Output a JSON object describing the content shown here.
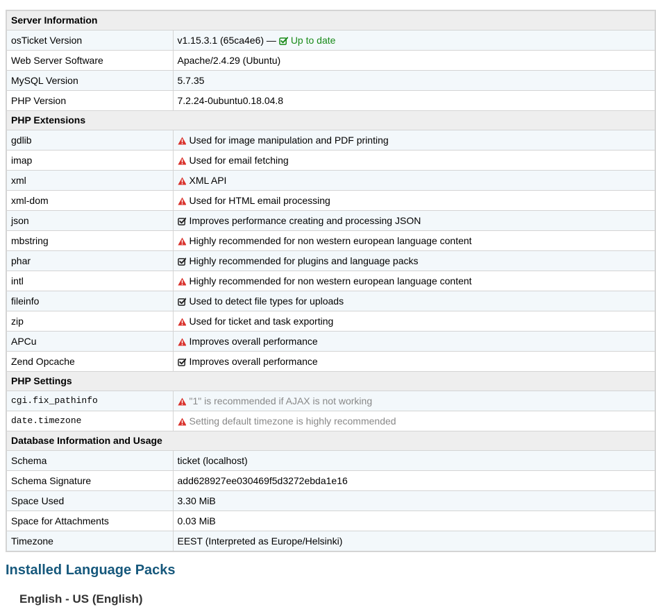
{
  "sections": [
    {
      "title": "Server Information",
      "rows": [
        {
          "key": "osTicket Version",
          "value": "v1.15.3.1 (65ca4e6) —",
          "status": "check-green",
          "extra": "Up to date"
        },
        {
          "key": "Web Server Software",
          "value": "Apache/2.4.29 (Ubuntu)"
        },
        {
          "key": "MySQL Version",
          "value": "5.7.35"
        },
        {
          "key": "PHP Version",
          "value": "7.2.24-0ubuntu0.18.04.8"
        }
      ]
    },
    {
      "title": "PHP Extensions",
      "rows": [
        {
          "key": "gdlib",
          "status": "warning",
          "value": "Used for image manipulation and PDF printing"
        },
        {
          "key": "imap",
          "status": "warning",
          "value": "Used for email fetching"
        },
        {
          "key": "xml",
          "status": "warning",
          "value": "XML API"
        },
        {
          "key": "xml-dom",
          "status": "warning",
          "value": "Used for HTML email processing"
        },
        {
          "key": "json",
          "status": "check",
          "value": "Improves performance creating and processing JSON"
        },
        {
          "key": "mbstring",
          "status": "warning",
          "value": "Highly recommended for non western european language content"
        },
        {
          "key": "phar",
          "status": "check",
          "value": "Highly recommended for plugins and language packs"
        },
        {
          "key": "intl",
          "status": "warning",
          "value": "Highly recommended for non western european language content"
        },
        {
          "key": "fileinfo",
          "status": "check",
          "value": "Used to detect file types for uploads"
        },
        {
          "key": "zip",
          "status": "warning",
          "value": "Used for ticket and task exporting"
        },
        {
          "key": "APCu",
          "status": "warning",
          "value": "Improves overall performance"
        },
        {
          "key": "Zend Opcache",
          "status": "check",
          "value": "Improves overall performance"
        }
      ]
    },
    {
      "title": "PHP Settings",
      "rows": [
        {
          "key": "cgi.fix_pathinfo",
          "mono": true,
          "muted": true,
          "status": "warning",
          "value": "\"1\" is recommended if AJAX is not working"
        },
        {
          "key": "date.timezone",
          "mono": true,
          "muted": true,
          "status": "warning",
          "value": "Setting default timezone is highly recommended"
        }
      ]
    },
    {
      "title": "Database Information and Usage",
      "rows": [
        {
          "key": "Schema",
          "value": "ticket (localhost)"
        },
        {
          "key": "Schema Signature",
          "value": "add628927ee030469f5d3272ebda1e16"
        },
        {
          "key": "Space Used",
          "value": "3.30 MiB"
        },
        {
          "key": "Space for Attachments",
          "value": "0.03 MiB"
        },
        {
          "key": "Timezone",
          "value": "EEST (Interpreted as Europe/Helsinki)"
        }
      ]
    }
  ],
  "language_packs": {
    "title": "Installed Language Packs",
    "items": [
      "English - US (English)"
    ]
  },
  "colors": {
    "warning": "#d9312b",
    "check": "#222222",
    "check_green": "#188a18",
    "heading": "#16587c"
  }
}
